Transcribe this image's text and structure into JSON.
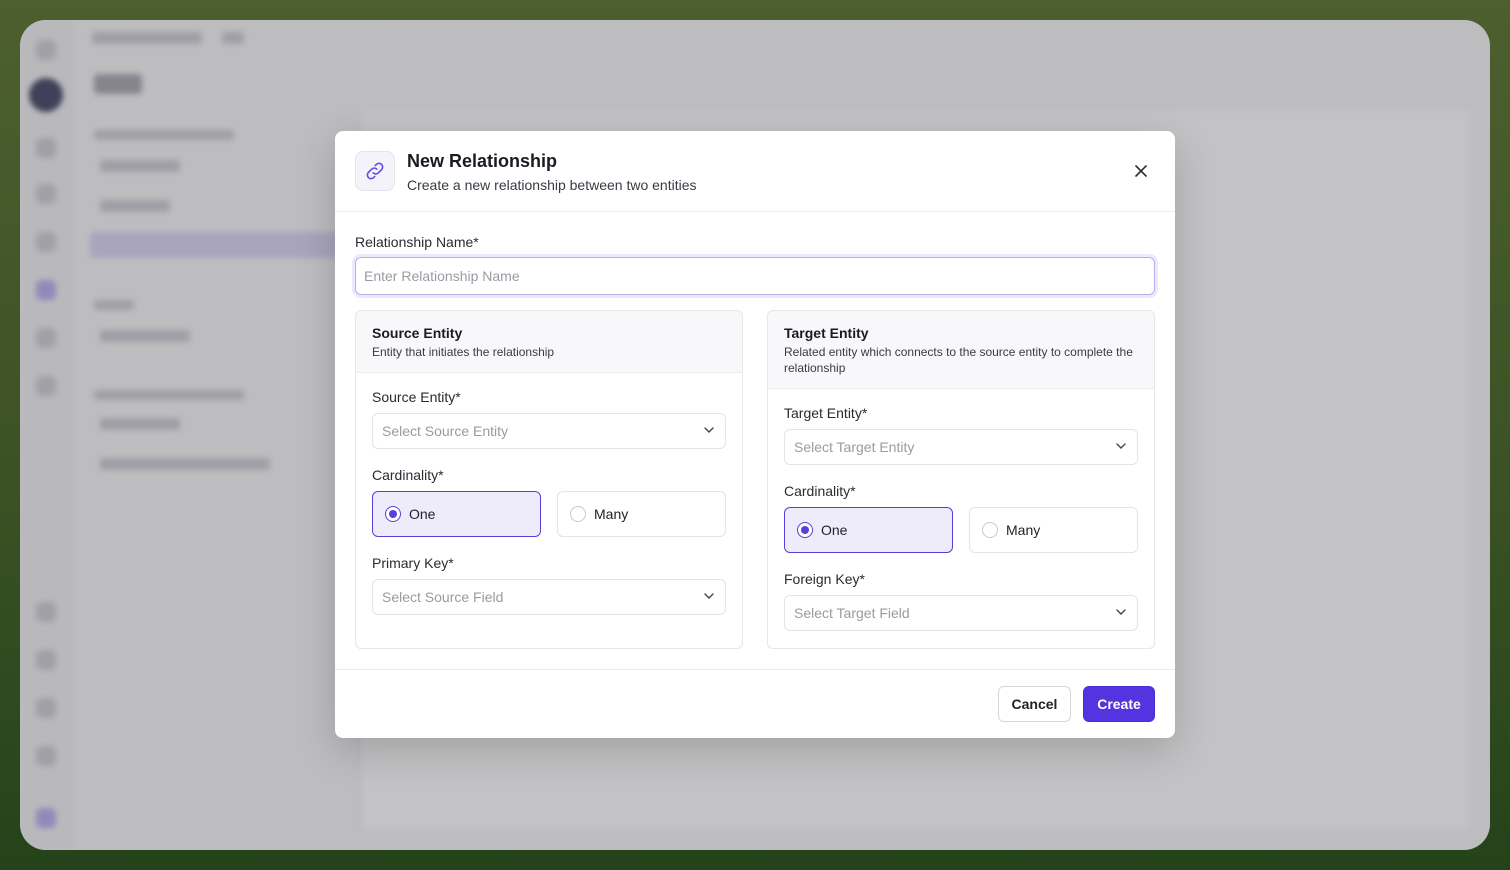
{
  "modal": {
    "title": "New Relationship",
    "subtitle": "Create a new relationship between two entities",
    "name_label": "Relationship Name*",
    "name_placeholder": "Enter Relationship Name",
    "name_value": ""
  },
  "source": {
    "title": "Source Entity",
    "description": "Entity that initiates the relationship",
    "entity_label": "Source Entity*",
    "entity_placeholder": "Select Source Entity",
    "cardinality_label": "Cardinality*",
    "options": [
      "One",
      "Many"
    ],
    "selected": "One",
    "key_label": "Primary Key*",
    "key_placeholder": "Select Source Field"
  },
  "target": {
    "title": "Target Entity",
    "description": "Related entity which connects to the source entity to complete the relationship",
    "entity_label": "Target Entity*",
    "entity_placeholder": "Select Target Entity",
    "cardinality_label": "Cardinality*",
    "options": [
      "One",
      "Many"
    ],
    "selected": "One",
    "key_label": "Foreign Key*",
    "key_placeholder": "Select Target Field"
  },
  "footer": {
    "cancel_label": "Cancel",
    "create_label": "Create"
  },
  "colors": {
    "accent": "#5234e0",
    "selected_bg": "#eeebfb"
  },
  "icons": [
    "link-icon",
    "close-icon",
    "chevron-down-icon",
    "radio-icon"
  ]
}
